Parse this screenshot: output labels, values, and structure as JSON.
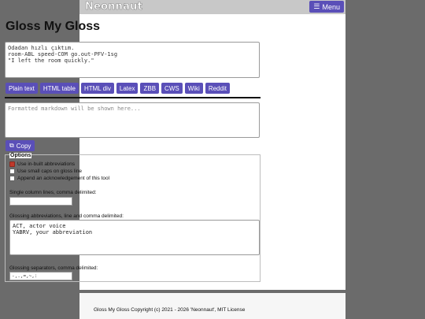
{
  "header": {
    "brand": "Neonnaut",
    "menu_label": "Menu"
  },
  "page_title": "Gloss My Gloss",
  "input_text": "Odadan hızlı çıktım.\nroom-ABL speed-COM go.out-PFV-1sg\n\"I left the room quickly.\"",
  "format_buttons": [
    "Plain text",
    "HTML table",
    "HTML div",
    "Latex",
    "ZBB",
    "CWS",
    "Wiki",
    "Reddit"
  ],
  "output_placeholder": "Formatted markdown will be shown here...",
  "copy_label": "Copy",
  "options": {
    "legend": "Options",
    "checkboxes": [
      {
        "label": "Use in-built abbreviations",
        "checked": true
      },
      {
        "label": "Use small caps on gloss line",
        "checked": false
      },
      {
        "label": "Append an acknowledgement of this tool",
        "checked": false
      }
    ],
    "single_column_label": "Single column lines, comma delimited:",
    "single_column_value": "",
    "abbreviations_label": "Glossing abbreviations, line and comma delimited:",
    "abbreviations_value": "ACT, actor voice\nYABRV, your abbreviation",
    "separators_label": "Glossing separators, comma delimited:",
    "separators_value": "-,.,=,~,:"
  },
  "footer": {
    "copyright": "Gloss My Gloss Copyright (c) 2021 - 2026 'Neonnaut', MIT License"
  },
  "colors": {
    "accent": "#5a4fb8",
    "checkbox_checked": "#c0392b"
  }
}
